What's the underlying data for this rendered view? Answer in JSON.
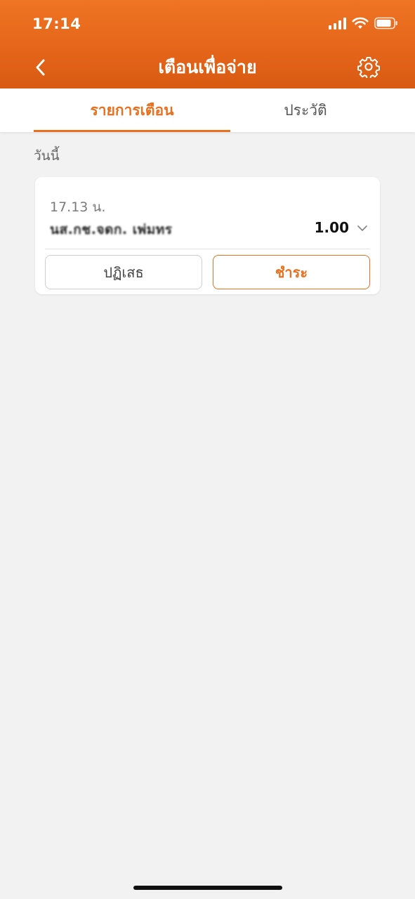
{
  "status_bar": {
    "time": "17:14"
  },
  "header": {
    "title": "เตือนเพื่อจ่าย"
  },
  "tabs": [
    {
      "label": "รายการเตือน",
      "active": true
    },
    {
      "label": "ประวัติ",
      "active": false
    }
  ],
  "section": {
    "label": "วันนี้"
  },
  "request": {
    "time": "17.13 น.",
    "payee": "นส.กช.จดก. เพ่มทร",
    "amount": "1.00",
    "reject_label": "ปฏิเสธ",
    "pay_label": "ชำระ"
  },
  "colors": {
    "brand_orange": "#e8701f",
    "header_gradient_top": "#ef7423",
    "header_gradient_bottom": "#d85a12",
    "background": "#f2f2f2"
  },
  "icons": {
    "back": "chevron-left-icon",
    "settings": "gear-icon",
    "expand": "chevron-down-icon",
    "signal": "signal-icon",
    "wifi": "wifi-icon",
    "battery": "battery-icon"
  }
}
